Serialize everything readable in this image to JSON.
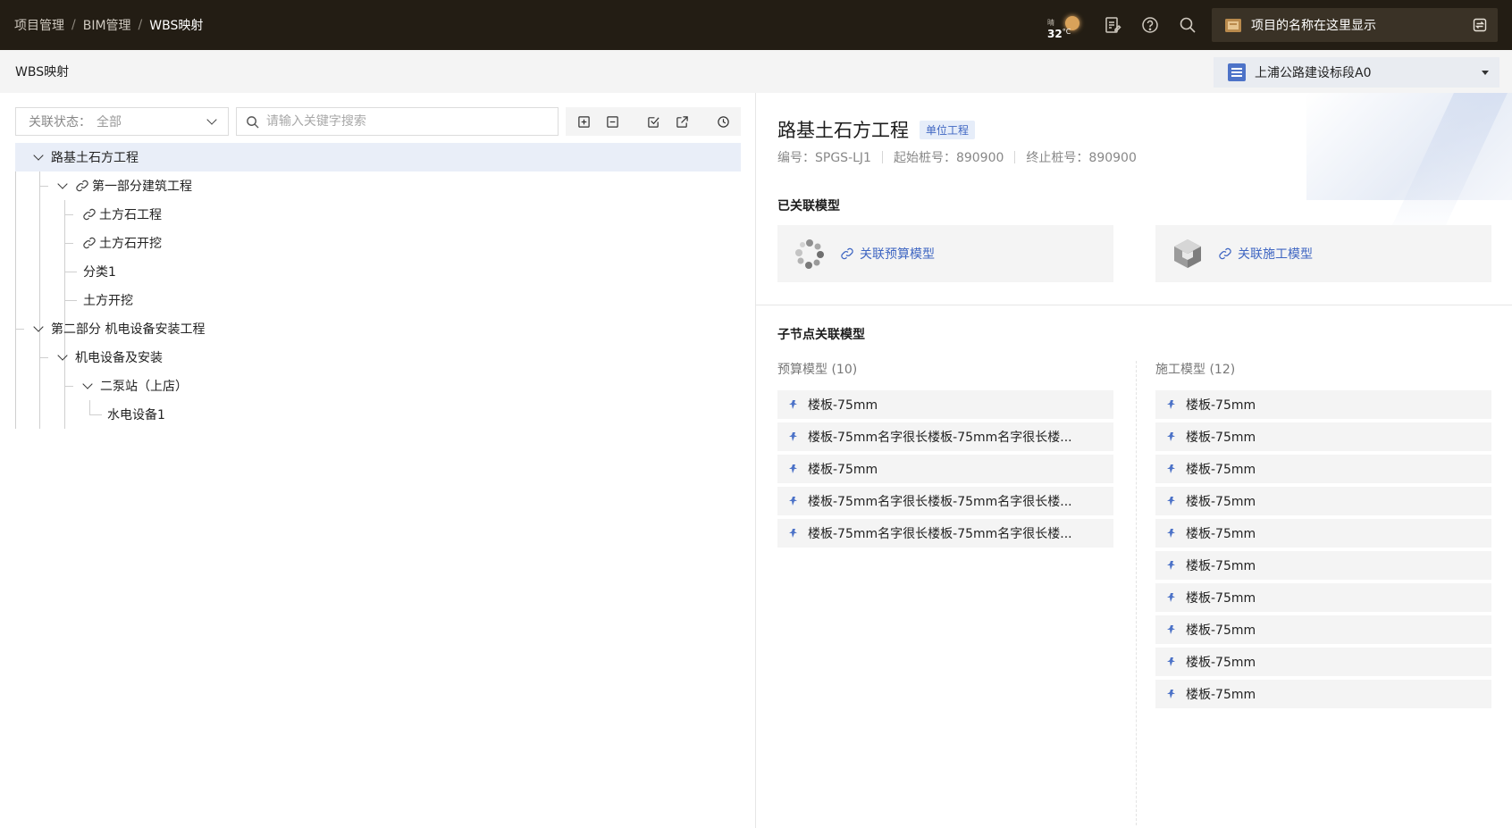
{
  "header": {
    "breadcrumbs": [
      "项目管理",
      "BIM管理",
      "WBS映射"
    ],
    "weather": {
      "condition": "晴",
      "temp": "32",
      "unit": "°C"
    },
    "project_name": "项目的名称在这里显示",
    "icons": [
      "notes-icon",
      "help-icon",
      "search-icon",
      "switch-icon"
    ]
  },
  "subheader": {
    "title": "WBS映射",
    "section": "上浦公路建设标段A0"
  },
  "left": {
    "status_label": "关联状态：",
    "status_value": "全部",
    "search_placeholder": "请输入关键字搜索",
    "tools": [
      "expand-all-icon",
      "collapse-all-icon",
      "check-icon",
      "export-icon",
      "history-icon"
    ],
    "tree": [
      {
        "label": "路基土石方工程",
        "level": 0,
        "expanded": true,
        "linked": false,
        "selected": true
      },
      {
        "label": "第一部分建筑工程",
        "level": 1,
        "expanded": true,
        "linked": true
      },
      {
        "label": "土方石工程",
        "level": 2,
        "linked": true
      },
      {
        "label": "土方石开挖",
        "level": 2,
        "linked": true
      },
      {
        "label": "分类1",
        "level": 2,
        "linked": false
      },
      {
        "label": "土方开挖",
        "level": 2,
        "linked": false
      },
      {
        "label": "第二部分 机电设备安装工程",
        "level": 0,
        "expanded": true,
        "linked": false
      },
      {
        "label": "机电设备及安装",
        "level": 1,
        "expanded": true,
        "linked": false
      },
      {
        "label": "二泵站（上店）",
        "level": 2,
        "expanded": true,
        "linked": false
      },
      {
        "label": "水电设备1",
        "level": 3,
        "linked": false
      }
    ]
  },
  "right": {
    "title": "路基土石方工程",
    "badge": "单位工程",
    "code_label": "编号：SPGS-LJ1",
    "start_label": "起始桩号：890900",
    "end_label": "终止桩号：890900",
    "linked_title": "已关联模型",
    "link_budget": "关联预算模型",
    "link_construction": "关联施工模型",
    "children_title": "子节点关联模型",
    "budget_head": "预算模型 (10)",
    "construction_head": "施工模型 (12)",
    "budget_items": [
      "楼板-75mm",
      "楼板-75mm名字很长楼板-75mm名字很长楼...",
      "楼板-75mm",
      "楼板-75mm名字很长楼板-75mm名字很长楼...",
      "楼板-75mm名字很长楼板-75mm名字很长楼..."
    ],
    "construction_items": [
      "楼板-75mm",
      "楼板-75mm",
      "楼板-75mm",
      "楼板-75mm",
      "楼板-75mm",
      "楼板-75mm",
      "楼板-75mm",
      "楼板-75mm",
      "楼板-75mm",
      "楼板-75mm"
    ]
  },
  "colors": {
    "topbar": "#231d14",
    "accent": "#3f66c2",
    "selected_row": "#e9eef8"
  }
}
